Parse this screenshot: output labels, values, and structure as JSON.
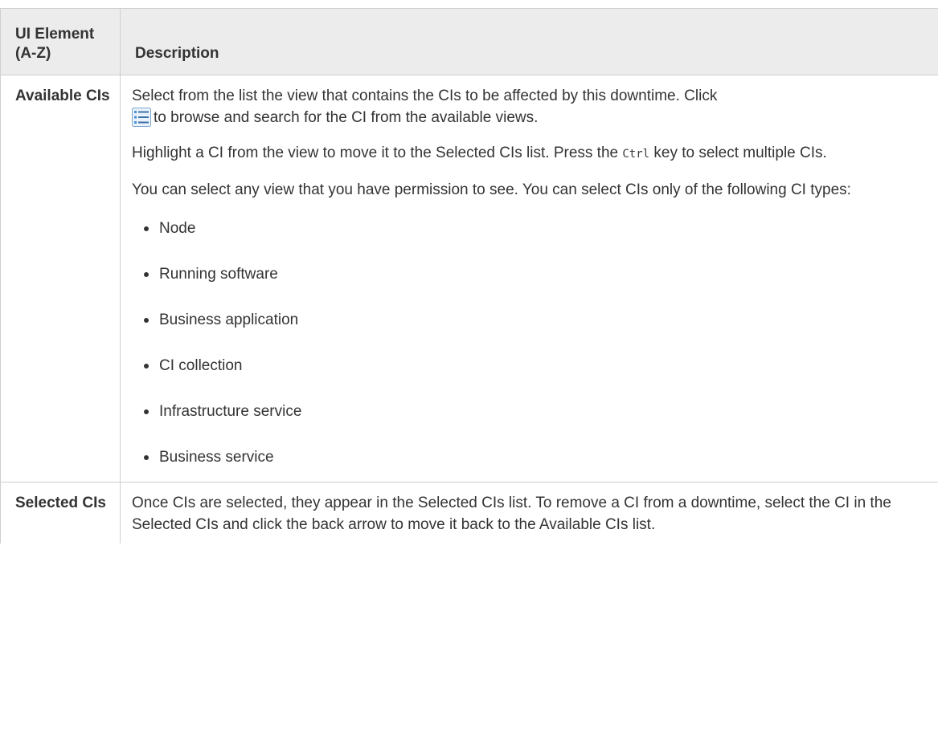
{
  "table": {
    "headers": {
      "element": "UI Element (A-Z)",
      "description": "Description"
    },
    "rows": [
      {
        "element": "Available CIs",
        "para1_before_icon": "Select from the list the view that contains the CIs to be affected by this downtime. Click",
        "para1_icon": "list-browse-icon",
        "para1_after_icon": "to browse and search for the CI from the available views.",
        "para2_before_code": "Highlight a CI from the view to move it to the Selected CIs list. Press the",
        "para2_code": "Ctrl",
        "para2_after_code": "key to select multiple CIs.",
        "para3": "You can select any view that you have permission to see. You can select CIs only of the following CI types:",
        "ci_types": [
          "Node",
          "Running software",
          "Business application",
          "CI collection",
          "Infrastructure service",
          "Business service"
        ]
      },
      {
        "element": "Selected CIs",
        "description": "Once CIs are selected, they appear in the Selected CIs list. To remove a CI from a downtime, select the CI in the Selected CIs and click the back arrow to move it back to the Available CIs list."
      }
    ]
  },
  "colors": {
    "header_bg": "#ececec",
    "border": "#cfcfcf",
    "text": "#333333"
  }
}
